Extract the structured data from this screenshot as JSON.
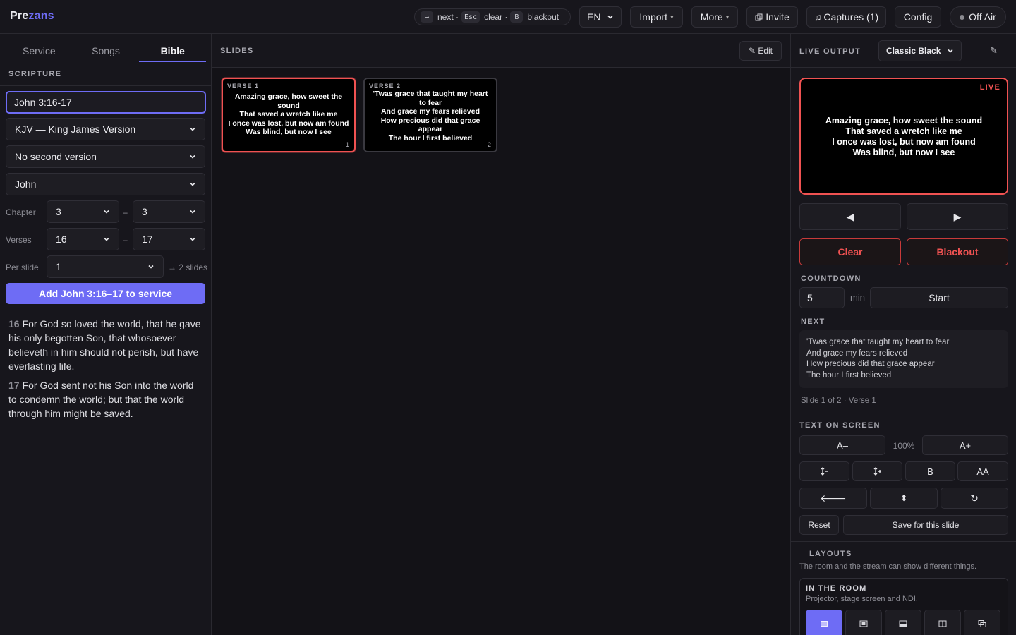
{
  "app": {
    "name_part1": "Pre",
    "name_part2": "zans"
  },
  "topbar": {
    "hints": [
      {
        "key": "→",
        "label": "next ·"
      },
      {
        "key": "Esc",
        "label": "clear ·"
      },
      {
        "key": "B",
        "label": "blackout"
      }
    ],
    "language": "EN",
    "import_label": "Import",
    "more_label": "More",
    "invite_label": "Invite",
    "captures_label": "Captures (1)",
    "config_label": "Config",
    "offair_label": "Off Air"
  },
  "left": {
    "tabs": [
      "Service",
      "Songs",
      "Bible"
    ],
    "active_tab": "Bible",
    "section_title": "SCRIPTURE",
    "reference_value": "John 3:16-17",
    "version": "KJV — King James Version",
    "second_version": "No second version",
    "book": "John",
    "chapter_label": "Chapter",
    "chapter_from": "3",
    "chapter_to": "3",
    "verses_label": "Verses",
    "verse_from": "16",
    "verse_to": "17",
    "per_slide_label": "Per slide",
    "per_slide": "1",
    "slides_count": "→ 2 slides",
    "add_button": "Add John 3:16–17 to service",
    "verses": [
      {
        "num": "16",
        "text": "For God so loved the world, that he gave his only begotten Son, that whosoever believeth in him should not perish, but have everlasting life."
      },
      {
        "num": "17",
        "text": "For God sent not his Son into the world to condemn the world; but that the world through him might be saved."
      }
    ]
  },
  "center": {
    "title": "SLIDES",
    "edit_label": "✎ Edit",
    "slides": [
      {
        "tag": "VERSE 1",
        "lines": [
          "Amazing grace, how sweet the sound",
          "That saved a wretch like me",
          "I once was lost, but now am found",
          "Was blind, but now I see"
        ],
        "index": "1"
      },
      {
        "tag": "VERSE 2",
        "lines": [
          "'Twas grace that taught my heart to fear",
          "And grace my fears relieved",
          "How precious did that grace appear",
          "The hour I first believed"
        ],
        "index": "2"
      }
    ]
  },
  "right": {
    "title": "LIVE OUTPUT",
    "theme": "Classic Black",
    "live_tag": "LIVE",
    "preview_lines": [
      "Amazing grace, how sweet the sound",
      "That saved a wretch like me",
      "I once was lost, but now am found",
      "Was blind, but now I see"
    ],
    "prev_label": "◀",
    "next_label": "▶",
    "clear_label": "Clear",
    "blackout_label": "Blackout",
    "countdown_title": "COUNTDOWN",
    "countdown_value": "5",
    "countdown_unit": "min",
    "start_label": "Start",
    "next_title": "NEXT",
    "next_lines": [
      "'Twas grace that taught my heart to fear",
      "And grace my fears relieved",
      "How precious did that grace appear",
      "The hour I first believed"
    ],
    "slide_info": "Slide 1 of 2 · Verse 1",
    "text_title": "TEXT ON SCREEN",
    "font_smaller": "A–",
    "font_size_pct": "100%",
    "font_larger": "A+",
    "bold_label": "B",
    "caps_label": "AA",
    "reset_label": "Reset",
    "save_label": "Save for this slide",
    "layouts_title": "LAYOUTS",
    "layouts_desc": "The room and the stream can show different things.",
    "room_title": "IN THE ROOM",
    "room_desc": "Projector, stage screen and NDI."
  }
}
